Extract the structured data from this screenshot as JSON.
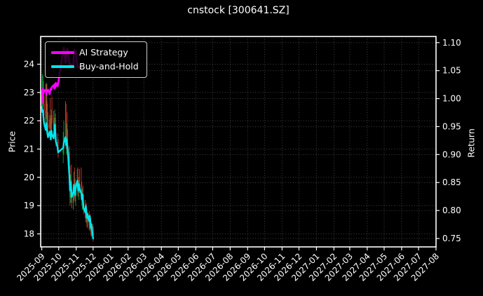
{
  "title": "cnstock [300641.SZ]",
  "chart_data": {
    "type": "candlestick+line",
    "title": "cnstock [300641.SZ]",
    "ylabel_left": "Price",
    "ylabel_right": "Return",
    "grid": true,
    "legend_position": "upper left",
    "legend": [
      {
        "label": "AI Strategy",
        "color": "#ff00ff"
      },
      {
        "label": "Buy-and-Hold",
        "color": "#00e5ee"
      }
    ],
    "colors": {
      "background": "#000000",
      "text": "#ffffff",
      "grid": "rgba(255,255,255,0.30)",
      "spine": "#ffffff",
      "candle_up": "#00a043",
      "candle_down": "#d93528",
      "ai_strategy": "#ff00ff",
      "buy_and_hold": "#00e5ee"
    },
    "x_domain": [
      "2025-08-30",
      "2027-08-01"
    ],
    "x_tick_labels": [
      "2025-09",
      "2025-10",
      "2025-11",
      "2025-12",
      "2026-01",
      "2026-02",
      "2026-03",
      "2026-04",
      "2026-05",
      "2026-06",
      "2026-07",
      "2026-08",
      "2026-09",
      "2026-10",
      "2026-11",
      "2026-12",
      "2027-01",
      "2027-02",
      "2027-03",
      "2027-04",
      "2027-05",
      "2027-06",
      "2027-07",
      "2027-08"
    ],
    "price_ticks": [
      18,
      19,
      20,
      21,
      22,
      23,
      24
    ],
    "return_tick_labels": [
      "0.75",
      "0.80",
      "0.85",
      "0.90",
      "0.95",
      "1.00",
      "1.05",
      "1.10"
    ],
    "price_ylim": [
      17.54,
      24.98
    ],
    "return_ylim": [
      0.735,
      1.111
    ],
    "candles": {
      "dates": [
        "2025-09-01",
        "2025-09-02",
        "2025-09-03",
        "2025-09-04",
        "2025-09-05",
        "2025-09-08",
        "2025-09-09",
        "2025-09-10",
        "2025-09-11",
        "2025-09-12",
        "2025-09-15",
        "2025-09-16",
        "2025-09-17",
        "2025-09-18",
        "2025-09-19",
        "2025-09-22",
        "2025-09-23",
        "2025-09-24",
        "2025-09-25",
        "2025-09-26",
        "2025-09-29",
        "2025-09-30",
        "2025-10-09",
        "2025-10-10",
        "2025-10-13",
        "2025-10-14",
        "2025-10-15",
        "2025-10-16",
        "2025-10-17",
        "2025-10-20",
        "2025-10-21",
        "2025-10-22",
        "2025-10-23",
        "2025-10-24",
        "2025-10-27",
        "2025-10-28",
        "2025-10-29",
        "2025-10-30",
        "2025-10-31",
        "2025-11-03",
        "2025-11-04",
        "2025-11-05",
        "2025-11-06",
        "2025-11-07",
        "2025-11-10",
        "2025-11-11",
        "2025-11-12",
        "2025-11-13",
        "2025-11-14",
        "2025-11-17",
        "2025-11-18",
        "2025-11-19",
        "2025-11-20",
        "2025-11-21",
        "2025-11-24",
        "2025-11-25",
        "2025-11-26",
        "2025-11-27",
        "2025-11-28",
        "2025-12-01"
      ],
      "open": [
        22.85,
        22.5,
        22.95,
        23.05,
        22.6,
        22.35,
        22.05,
        22.7,
        22.25,
        21.9,
        21.75,
        22.05,
        21.85,
        21.7,
        22.2,
        22.0,
        21.8,
        21.95,
        22.1,
        21.55,
        21.25,
        21.0,
        20.85,
        21.05,
        21.3,
        21.45,
        21.15,
        21.35,
        21.1,
        20.9,
        19.75,
        19.3,
        19.85,
        19.55,
        19.1,
        19.45,
        19.7,
        19.5,
        19.3,
        19.6,
        19.9,
        19.65,
        19.45,
        19.75,
        19.55,
        19.4,
        19.15,
        19.35,
        19.1,
        18.85,
        18.7,
        18.9,
        18.6,
        18.4,
        18.55,
        18.3,
        18.5,
        18.35,
        18.1,
        18.25
      ],
      "high": [
        23.1,
        23.65,
        23.6,
        23.4,
        22.9,
        23.3,
        23.35,
        23.3,
        22.6,
        22.3,
        22.2,
        22.8,
        22.1,
        22.4,
        22.85,
        22.35,
        22.1,
        22.4,
        22.25,
        21.9,
        21.55,
        21.35,
        21.6,
        22.0,
        22.7,
        22.6,
        21.9,
        22.3,
        21.7,
        21.1,
        20.4,
        20.1,
        20.45,
        19.9,
        19.6,
        20.2,
        20.35,
        19.95,
        19.8,
        20.3,
        20.35,
        20.0,
        19.9,
        20.3,
        20.35,
        19.85,
        19.6,
        19.7,
        19.4,
        19.2,
        19.05,
        19.1,
        18.85,
        18.75,
        18.8,
        18.65,
        18.7,
        18.55,
        18.4,
        18.35
      ],
      "low": [
        22.3,
        22.4,
        22.6,
        22.5,
        22.2,
        21.9,
        21.8,
        22.1,
        21.75,
        21.6,
        21.55,
        21.7,
        21.55,
        21.6,
        21.9,
        21.7,
        21.5,
        21.75,
        21.4,
        21.1,
        20.85,
        20.7,
        20.5,
        20.8,
        21.1,
        21.0,
        20.8,
        21.0,
        20.7,
        19.6,
        19.0,
        19.1,
        19.4,
        18.9,
        18.85,
        19.2,
        19.3,
        19.15,
        19.0,
        19.35,
        19.5,
        19.3,
        19.2,
        19.45,
        19.25,
        19.0,
        18.85,
        19.0,
        18.7,
        18.55,
        18.4,
        18.45,
        18.25,
        18.2,
        18.15,
        18.1,
        18.2,
        17.95,
        17.9,
        17.75
      ],
      "close": [
        22.5,
        22.95,
        23.05,
        22.6,
        22.35,
        22.05,
        22.7,
        22.25,
        21.9,
        21.75,
        22.05,
        21.85,
        21.7,
        22.2,
        22.0,
        21.8,
        21.95,
        22.1,
        21.55,
        21.25,
        21.0,
        20.85,
        21.05,
        21.3,
        21.45,
        21.15,
        21.35,
        21.1,
        20.9,
        19.75,
        19.3,
        19.85,
        19.55,
        19.1,
        19.45,
        19.7,
        19.5,
        19.3,
        19.6,
        19.9,
        19.65,
        19.45,
        19.75,
        19.55,
        19.4,
        19.15,
        19.35,
        19.1,
        18.85,
        18.7,
        18.9,
        18.6,
        18.4,
        18.55,
        18.3,
        18.5,
        18.35,
        18.1,
        18.25,
        17.9
      ]
    },
    "series": [
      {
        "name": "AI Strategy",
        "axis": "return",
        "values": [
          0.992,
          1.006,
          1.018,
          1.009,
          1.014,
          1.016,
          1.007,
          1.015,
          1.013,
          1.016,
          1.008,
          1.014,
          1.018,
          1.016,
          1.021,
          1.024,
          1.018,
          1.026,
          1.02,
          1.028,
          1.022,
          1.027,
          1.086,
          1.091,
          1.064,
          1.071,
          1.086,
          1.089,
          1.087,
          1.062,
          1.06,
          1.062,
          1.059,
          1.061,
          1.058,
          1.084,
          1.087,
          1.086,
          1.085,
          1.058,
          1.056,
          1.057,
          1.056,
          1.057,
          1.056
        ]
      },
      {
        "name": "Buy-and-Hold",
        "axis": "return",
        "values": [
          0.985,
          0.976,
          0.979,
          0.966,
          0.956,
          0.944,
          0.956,
          0.947,
          0.937,
          0.931,
          0.941,
          0.934,
          0.927,
          0.943,
          0.936,
          0.929,
          0.939,
          0.953,
          0.94,
          0.923,
          0.913,
          0.904,
          0.912,
          0.921,
          0.931,
          0.917,
          0.927,
          0.919,
          0.909,
          0.86,
          0.836,
          0.851,
          0.84,
          0.824,
          0.833,
          0.846,
          0.838,
          0.828,
          0.841,
          0.853,
          0.843,
          0.836,
          0.847,
          0.839,
          0.831,
          0.82,
          0.829,
          0.817,
          0.805,
          0.797,
          0.808,
          0.799,
          0.787,
          0.794,
          0.781,
          0.79,
          0.783,
          0.769,
          0.775,
          0.75
        ]
      }
    ]
  }
}
